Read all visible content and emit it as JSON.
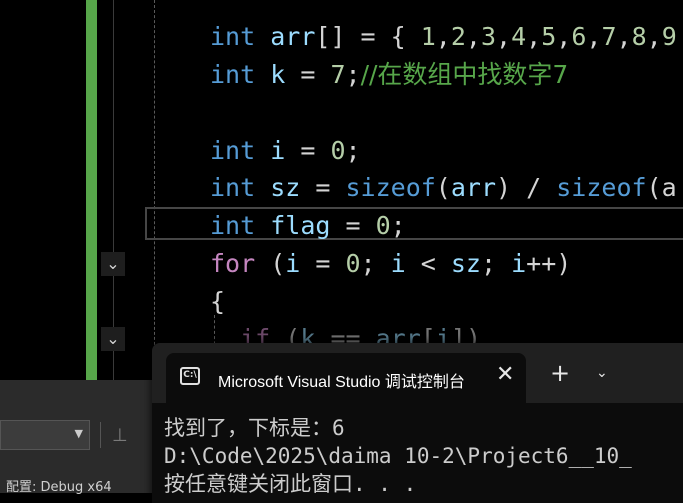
{
  "editor": {
    "code_lines": [
      {
        "line_id": 1,
        "tokens": [
          {
            "t": "int",
            "c": "kw"
          },
          {
            "t": " ",
            "c": ""
          },
          {
            "t": "arr",
            "c": "var"
          },
          {
            "t": "[] = { ",
            "c": ""
          },
          {
            "t": "1",
            "c": "num"
          },
          {
            "t": ",",
            "c": ""
          },
          {
            "t": "2",
            "c": "num"
          },
          {
            "t": ",",
            "c": ""
          },
          {
            "t": "3",
            "c": "num"
          },
          {
            "t": ",",
            "c": ""
          },
          {
            "t": "4",
            "c": "num"
          },
          {
            "t": ",",
            "c": ""
          },
          {
            "t": "5",
            "c": "num"
          },
          {
            "t": ",",
            "c": ""
          },
          {
            "t": "6",
            "c": "num"
          },
          {
            "t": ",",
            "c": ""
          },
          {
            "t": "7",
            "c": "num"
          },
          {
            "t": ",",
            "c": ""
          },
          {
            "t": "8",
            "c": "num"
          },
          {
            "t": ",",
            "c": ""
          },
          {
            "t": "9",
            "c": "num"
          }
        ]
      },
      {
        "line_id": 2,
        "tokens": [
          {
            "t": "int",
            "c": "kw"
          },
          {
            "t": " ",
            "c": ""
          },
          {
            "t": "k",
            "c": "var"
          },
          {
            "t": " = ",
            "c": ""
          },
          {
            "t": "7",
            "c": "num"
          },
          {
            "t": ";",
            "c": ""
          },
          {
            "t": "//在数组中找数字7",
            "c": "cmt"
          }
        ]
      },
      {
        "line_id": 3,
        "tokens": []
      },
      {
        "line_id": 4,
        "tokens": [
          {
            "t": "int",
            "c": "kw"
          },
          {
            "t": " ",
            "c": ""
          },
          {
            "t": "i",
            "c": "var"
          },
          {
            "t": " = ",
            "c": ""
          },
          {
            "t": "0",
            "c": "num"
          },
          {
            "t": ";",
            "c": ""
          }
        ]
      },
      {
        "line_id": 5,
        "tokens": [
          {
            "t": "int",
            "c": "kw"
          },
          {
            "t": " ",
            "c": ""
          },
          {
            "t": "sz",
            "c": "var"
          },
          {
            "t": " = ",
            "c": ""
          },
          {
            "t": "sizeof",
            "c": "kw"
          },
          {
            "t": "(",
            "c": ""
          },
          {
            "t": "arr",
            "c": "var"
          },
          {
            "t": ") / ",
            "c": ""
          },
          {
            "t": "sizeof",
            "c": "kw"
          },
          {
            "t": "(a",
            "c": ""
          }
        ]
      },
      {
        "line_id": 6,
        "tokens": [
          {
            "t": "int",
            "c": "kw"
          },
          {
            "t": " ",
            "c": ""
          },
          {
            "t": "flag",
            "c": "var"
          },
          {
            "t": " = ",
            "c": ""
          },
          {
            "t": "0",
            "c": "num"
          },
          {
            "t": ";",
            "c": ""
          }
        ]
      },
      {
        "line_id": 7,
        "tokens": [
          {
            "t": "for",
            "c": "ctrl"
          },
          {
            "t": " (",
            "c": ""
          },
          {
            "t": "i",
            "c": "var"
          },
          {
            "t": " = ",
            "c": ""
          },
          {
            "t": "0",
            "c": "num"
          },
          {
            "t": "; ",
            "c": ""
          },
          {
            "t": "i",
            "c": "var"
          },
          {
            "t": " < ",
            "c": ""
          },
          {
            "t": "sz",
            "c": "var"
          },
          {
            "t": "; ",
            "c": ""
          },
          {
            "t": "i",
            "c": "var"
          },
          {
            "t": "++)",
            "c": ""
          }
        ]
      },
      {
        "line_id": 8,
        "tokens": [
          {
            "t": "{",
            "c": ""
          }
        ]
      },
      {
        "line_id": 9,
        "tokens": [
          {
            "t": "  ",
            "c": ""
          },
          {
            "t": "if",
            "c": "ctrl"
          },
          {
            "t": " (",
            "c": ""
          },
          {
            "t": "k",
            "c": "var"
          },
          {
            "t": " == ",
            "c": ""
          },
          {
            "t": "arr",
            "c": "var"
          },
          {
            "t": "[",
            "c": ""
          },
          {
            "t": "i",
            "c": "var"
          },
          {
            "t": "])",
            "c": ""
          }
        ]
      }
    ],
    "fold_glyph": "⌄",
    "colors": {
      "keyword": "#569cd6",
      "control": "#c586c0",
      "variable": "#9cdcfe",
      "number": "#b5cea8",
      "comment": "#57a64a",
      "change_bar": "#57a64a"
    }
  },
  "statusbar": {
    "config_label": "配置: Debug x64"
  },
  "console": {
    "icon": "console-icon",
    "title": "Microsoft Visual Studio 调试控制台",
    "close_glyph": "✕",
    "new_tab_glyph": "+",
    "dropdown_glyph": "⌄",
    "output_lines": [
      "找到了，下标是：6",
      "D:\\Code\\2025\\daima 10-2\\Project6__10_",
      "按任意键关闭此窗口. . ."
    ]
  }
}
